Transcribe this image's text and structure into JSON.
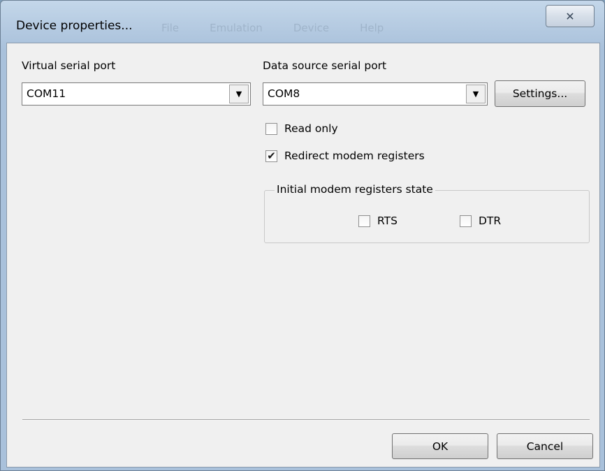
{
  "window": {
    "title": "Device properties...",
    "close_glyph": "✕",
    "background_menu": [
      "File",
      "Emulation",
      "Device",
      "Help"
    ]
  },
  "virtual_port": {
    "label": "Virtual serial port",
    "value": "COM11"
  },
  "source_port": {
    "label": "Data source serial port",
    "value": "COM8",
    "settings_label": "Settings..."
  },
  "options": {
    "read_only": {
      "label": "Read only",
      "checked": false
    },
    "redirect_modem": {
      "label": "Redirect modem registers",
      "checked": true
    }
  },
  "modem_group": {
    "title": "Initial modem registers state",
    "rts": {
      "label": "RTS",
      "checked": false
    },
    "dtr": {
      "label": "DTR",
      "checked": false
    }
  },
  "footer": {
    "ok_label": "OK",
    "cancel_label": "Cancel"
  },
  "icons": {
    "dropdown": "chevron-down-icon",
    "check": "checkmark-icon"
  }
}
